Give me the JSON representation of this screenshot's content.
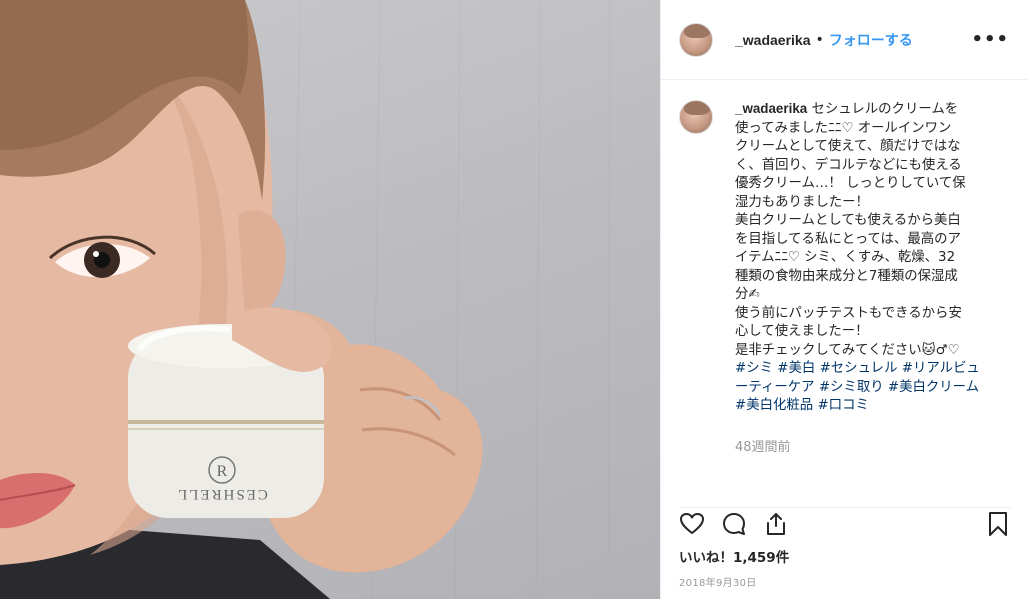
{
  "photo": {
    "jar_brand": "CESHRELL",
    "jar_monogram": "R"
  },
  "header": {
    "username": "_wadaerika",
    "separator": "•",
    "follow_label": "フォローする",
    "more_label": "•••"
  },
  "caption": {
    "username": "_wadaerika",
    "lines": [
      "セシュレルのクリームを",
      "使ってみましたﾆﾆ♡ オールインワン",
      "クリームとして使えて、顔だけではな",
      "く、首回り、デコルテなどにも使える",
      "優秀クリーム…！ しっとりしていて保",
      "湿力もありましたー！",
      "美白クリームとしても使えるから美白",
      "を目指してる私にとっては、最高のア",
      "イテムﾆﾆ♡ シミ、くすみ、乾燥、32",
      "種類の食物由来成分と7種類の保湿成",
      "分✍",
      "使う前にパッチテストもできるから安",
      "心して使えましたー！",
      "是非チェックしてみてください🐱♂♡"
    ],
    "tags": [
      "#シミ",
      "#美白",
      "#セシュレル",
      "#リアルビューティーケア",
      "#シミ取り",
      "#美白クリーム",
      "#美白化粧品",
      "#口コミ"
    ],
    "time_ago": "48週間前"
  },
  "actions": {
    "like_icon": "heart-icon",
    "comment_icon": "comment-icon",
    "share_icon": "share-icon",
    "save_icon": "bookmark-icon"
  },
  "likes_text": "いいね！1,459件",
  "date_text": "2018年9月30日",
  "colors": {
    "link": "#3897f0",
    "hashtag": "#003569",
    "muted": "#999999",
    "border": "#efefef"
  }
}
